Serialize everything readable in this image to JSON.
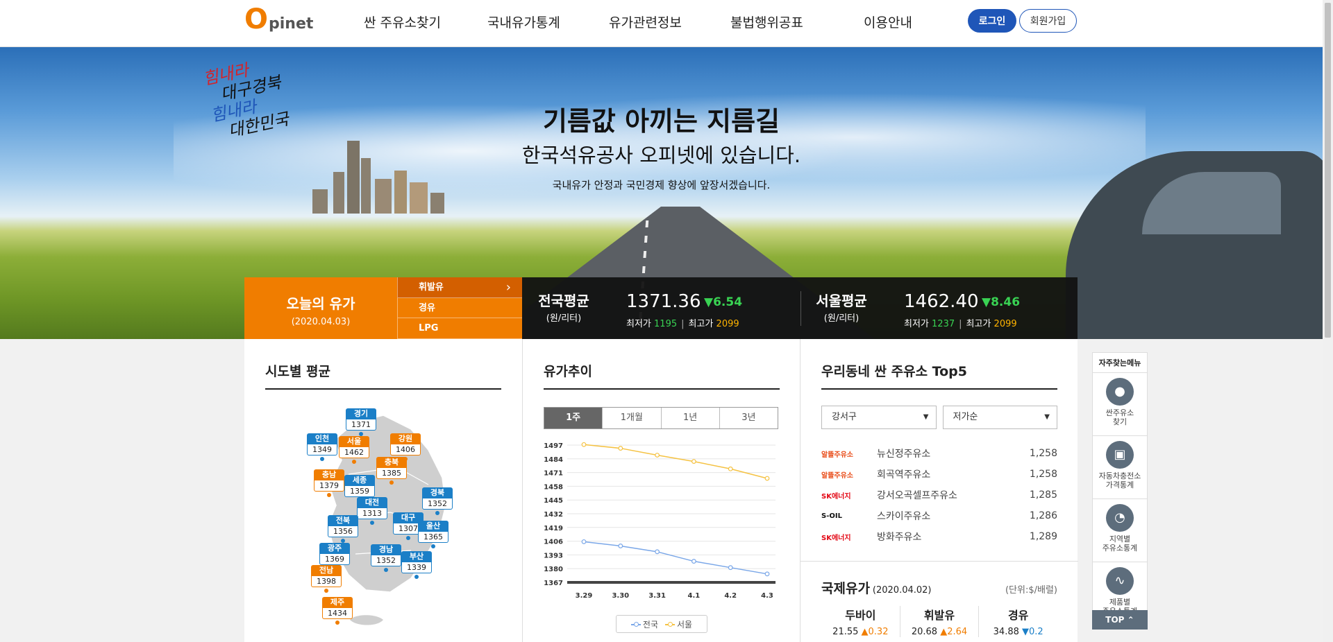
{
  "header": {
    "logo_o": "O",
    "logo_rest": "pinet",
    "nav": [
      "싼 주유소찾기",
      "국내유가통계",
      "유가관련정보",
      "불법행위공표",
      "이용안내"
    ],
    "login": "로그인",
    "join": "회원가입"
  },
  "hero": {
    "calligraphy": [
      "힘내라",
      "대구경북",
      "힘내라",
      "대한민국"
    ],
    "headline": "기름값 아끼는 지름길",
    "subheadline": "한국석유공사 오피넷에 있습니다.",
    "tagline": "국내유가 안정과 국민경제 향상에 앞장서겠습니다."
  },
  "today": {
    "title": "오늘의 유가",
    "date": "(2020.04.03)",
    "fuels": [
      "휘발유",
      "경유",
      "LPG"
    ],
    "national": {
      "label": "전국평균",
      "unit": "(원/리터)",
      "value": "1371.36",
      "change": "▼6.54",
      "min_label": "최저가",
      "min": "1195",
      "max_label": "최고가",
      "max": "2099"
    },
    "seoul": {
      "label": "서울평균",
      "unit": "(원/리터)",
      "value": "1462.40",
      "change": "▼8.46",
      "min_label": "최저가",
      "min": "1237",
      "max_label": "최고가",
      "max": "2099"
    }
  },
  "regional": {
    "title": "시도별 평균",
    "regions": [
      {
        "name": "경기",
        "value": "1371",
        "color": "b"
      },
      {
        "name": "인천",
        "value": "1349",
        "color": "b"
      },
      {
        "name": "서울",
        "value": "1462",
        "color": "o"
      },
      {
        "name": "강원",
        "value": "1406",
        "color": "o"
      },
      {
        "name": "충북",
        "value": "1385",
        "color": "o"
      },
      {
        "name": "충남",
        "value": "1379",
        "color": "o"
      },
      {
        "name": "세종",
        "value": "1359",
        "color": "b"
      },
      {
        "name": "경북",
        "value": "1352",
        "color": "b"
      },
      {
        "name": "대전",
        "value": "1313",
        "color": "b"
      },
      {
        "name": "전북",
        "value": "1356",
        "color": "b"
      },
      {
        "name": "대구",
        "value": "1307",
        "color": "b"
      },
      {
        "name": "울산",
        "value": "1365",
        "color": "b"
      },
      {
        "name": "광주",
        "value": "1369",
        "color": "b"
      },
      {
        "name": "경남",
        "value": "1352",
        "color": "b"
      },
      {
        "name": "부산",
        "value": "1339",
        "color": "b"
      },
      {
        "name": "전남",
        "value": "1398",
        "color": "o"
      },
      {
        "name": "제주",
        "value": "1434",
        "color": "o"
      }
    ]
  },
  "trend": {
    "title": "유가추이",
    "periods": [
      "1주",
      "1개월",
      "1년",
      "3년"
    ],
    "active_period": 0,
    "legend": [
      "전국",
      "서울"
    ]
  },
  "chart_data": {
    "type": "line",
    "x": [
      "3.29",
      "3.30",
      "3.31",
      "4.1",
      "4.2",
      "4.3"
    ],
    "series": [
      {
        "name": "전국",
        "values": [
          1405.5,
          1401.5,
          1396.0,
          1387.0,
          1381.0,
          1375.0
        ],
        "color": "#7aa7e8"
      },
      {
        "name": "서울",
        "values": [
          1497.5,
          1494.0,
          1487.5,
          1481.5,
          1474.5,
          1465.5
        ],
        "color": "#f5c242"
      }
    ],
    "yticks": [
      "1497",
      "1484",
      "1471",
      "1458",
      "1445",
      "1432",
      "1419",
      "1406",
      "1393",
      "1380",
      "1367"
    ],
    "ylim": [
      1367,
      1497
    ],
    "grid": true,
    "legend": "bottom"
  },
  "top5": {
    "title": "우리동네 싼 주유소 Top5",
    "district": "강서구",
    "sort": "저가순",
    "stations": [
      {
        "brand": "알뜰주유소",
        "brand_color": "#e94e1b",
        "name": "뉴신정주유소",
        "price": "1,258"
      },
      {
        "brand": "알뜰주유소",
        "brand_color": "#e94e1b",
        "name": "회곡역주유소",
        "price": "1,258"
      },
      {
        "brand": "SK에너지",
        "brand_color": "#e30613",
        "name": "강서오곡셀프주유소",
        "price": "1,285"
      },
      {
        "brand": "S-OIL",
        "brand_color": "#111111",
        "name": "스카이주유소",
        "price": "1,286"
      },
      {
        "brand": "SK에너지",
        "brand_color": "#e30613",
        "name": "방화주유소",
        "price": "1,289"
      }
    ]
  },
  "intl": {
    "title": "국제유가",
    "date": "(2020.04.02)",
    "unit": "(단위:$/배럴)",
    "items": [
      {
        "name": "두바이",
        "value": "21.55",
        "change": "▲0.32",
        "dir": "up"
      },
      {
        "name": "휘발유",
        "value": "20.68",
        "change": "▲2.64",
        "dir": "up"
      },
      {
        "name": "경유",
        "value": "34.88",
        "change": "▼0.2",
        "dir": "dn"
      }
    ]
  },
  "quick": {
    "title": "자주찾는메뉴",
    "items": [
      "싼주유소\n찾기",
      "자동차충전소\n가격통계",
      "지역별\n주유소통계",
      "제품별\n주유소통계"
    ],
    "top": "TOP"
  }
}
